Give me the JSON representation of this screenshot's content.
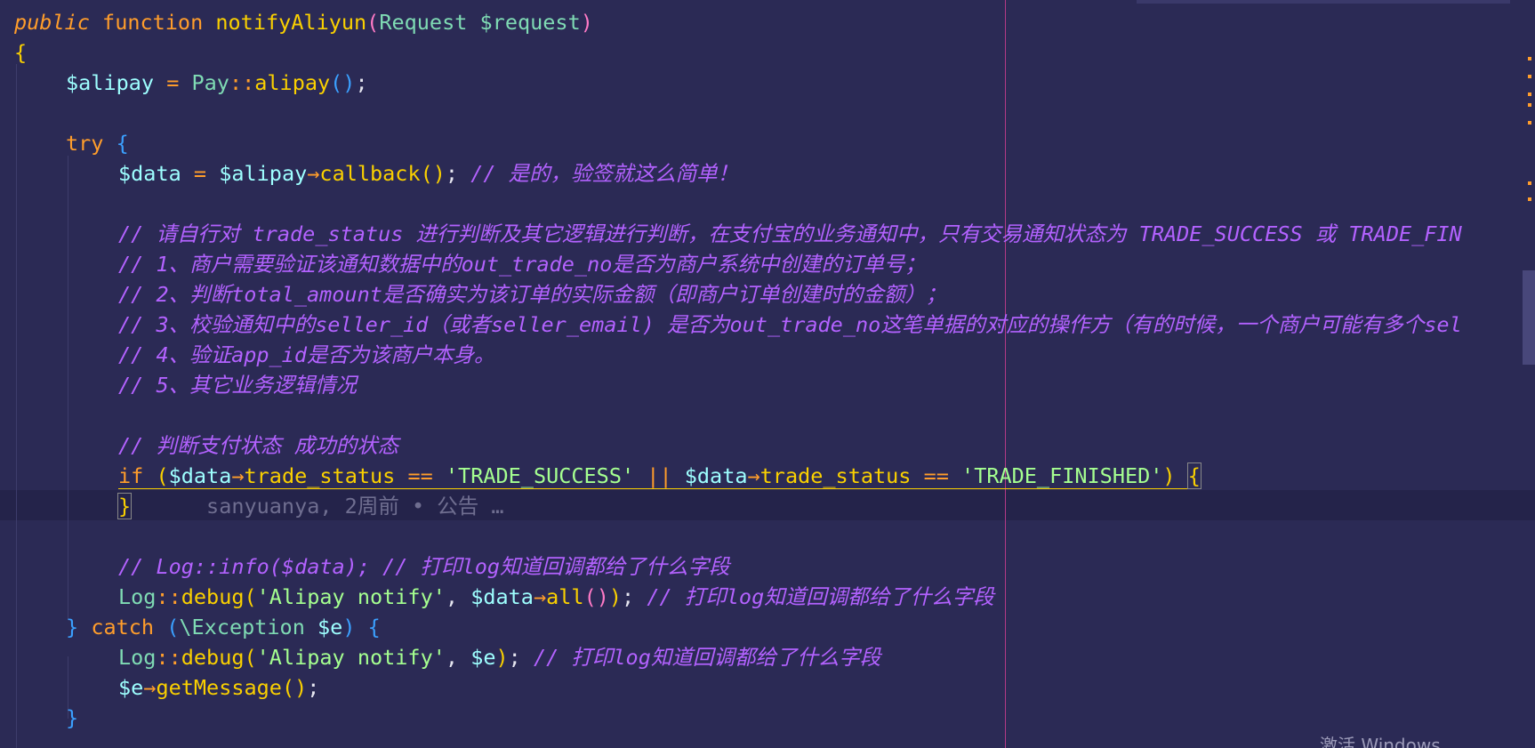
{
  "editor": {
    "blame": "sanyuanya, 2周前 • 公告 …",
    "watermark": "激活 Windows",
    "colors": {
      "background": "#2b2a55",
      "keyword": "#ff9d2b",
      "function": "#fad000",
      "variable": "#9effff",
      "string": "#a5ff90",
      "comment": "#b362ff",
      "ruler": "#b23a86"
    }
  },
  "code": {
    "l1": {
      "kw1": "public",
      "kw2": "function",
      "fn": "notifyAliyun",
      "p_open": "(",
      "type": "Request",
      "param": "$request",
      "p_close": ")"
    },
    "l2": {
      "brace": "{"
    },
    "l3": {
      "var": "$alipay",
      "op": "=",
      "cls": "Pay",
      "sep": "::",
      "fn": "alipay",
      "paren": "()",
      "semi": ";"
    },
    "l5": {
      "kw": "try",
      "brace": "{"
    },
    "l6": {
      "var": "$data",
      "op": "=",
      "var2": "$alipay",
      "arrow": "→",
      "fn": "callback",
      "paren": "()",
      "semi": ";",
      "comment": "// 是的，验签就这么简单！"
    },
    "l8": {
      "comment": "// 请自行对 trade_status 进行判断及其它逻辑进行判断，在支付宝的业务通知中，只有交易通知状态为 TRADE_SUCCESS 或 TRADE_FIN"
    },
    "l9": {
      "comment": "// 1、商户需要验证该通知数据中的out_trade_no是否为商户系统中创建的订单号；"
    },
    "l10": {
      "comment": "// 2、判断total_amount是否确实为该订单的实际金额（即商户订单创建时的金额）；"
    },
    "l11": {
      "comment": "// 3、校验通知中的seller_id（或者seller_email) 是否为out_trade_no这笔单据的对应的操作方（有的时候，一个商户可能有多个sel"
    },
    "l12": {
      "comment": "// 4、验证app_id是否为该商户本身。"
    },
    "l13": {
      "comment": "// 5、其它业务逻辑情况"
    },
    "l15": {
      "comment": "// 判断支付状态 成功的状态"
    },
    "l16": {
      "kw": "if",
      "p_open": "(",
      "var": "$data",
      "arrow": "→",
      "prop": "trade_status",
      "eq": "==",
      "str1": "'TRADE_SUCCESS'",
      "or": "||",
      "var2": "$data",
      "arrow2": "→",
      "prop2": "trade_status",
      "eq2": "==",
      "str2": "'TRADE_FINISHED'",
      "p_close": ")",
      "brace": "{"
    },
    "l17": {
      "brace": "}"
    },
    "l19": {
      "comment": "// Log::info($data); // 打印log知道回调都给了什么字段"
    },
    "l20": {
      "cls": "Log",
      "sep": "::",
      "fn": "debug",
      "p_open": "(",
      "str": "'Alipay notify'",
      "comma": ",",
      "var": "$data",
      "arrow": "→",
      "fn2": "all",
      "paren": "()",
      "p_close": ")",
      "semi": ";",
      "comment": "// 打印log知道回调都给了什么字段"
    },
    "l21": {
      "brace_close": "}",
      "kw": "catch",
      "p_open": "(",
      "cls": "\\Exception",
      "var": "$e",
      "p_close": ")",
      "brace": "{"
    },
    "l22": {
      "cls": "Log",
      "sep": "::",
      "fn": "debug",
      "p_open": "(",
      "str": "'Alipay notify'",
      "comma": ",",
      "var": "$e",
      "p_close": ")",
      "semi": ";",
      "comment": "// 打印log知道回调都给了什么字段"
    },
    "l23": {
      "var": "$e",
      "arrow": "→",
      "fn": "getMessage",
      "paren": "()",
      "semi": ";"
    },
    "l24": {
      "brace": "}"
    }
  }
}
